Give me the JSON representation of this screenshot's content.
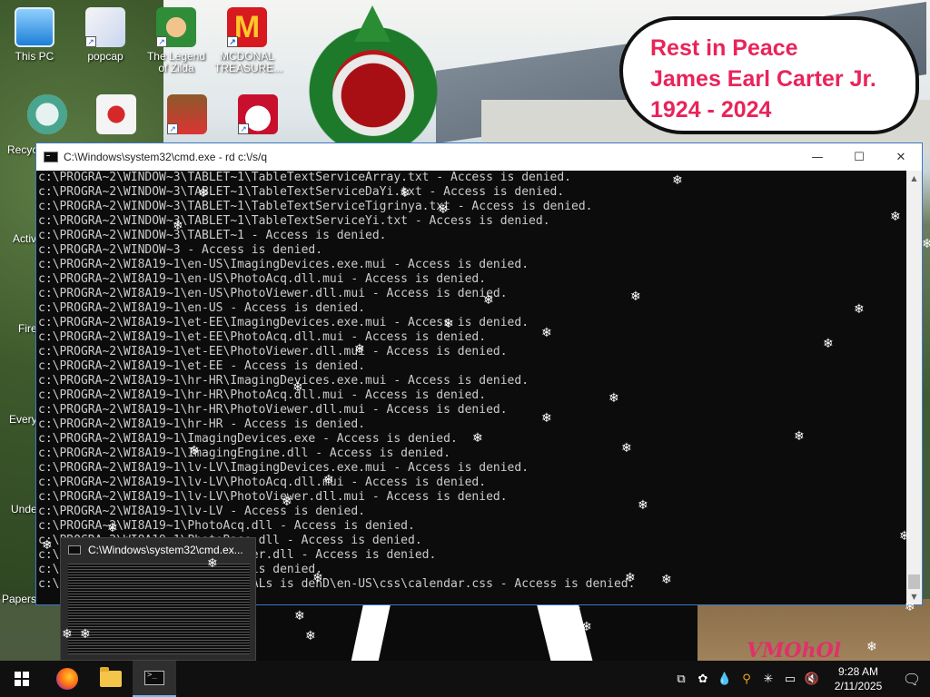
{
  "desktop": {
    "icons": [
      {
        "label": "This PC"
      },
      {
        "label": "popcap"
      },
      {
        "label": "The Legend of Zilda"
      },
      {
        "label": "MCDONAL TREASURE..."
      }
    ],
    "edge_labels": [
      "Recyc",
      "Activ",
      "Fire",
      "Every",
      "Unde",
      "Papers"
    ],
    "memorial": {
      "line1": "Rest in Peace",
      "line2": "James Earl Carter Jr.",
      "line3": "1924 - 2024"
    },
    "wallpaper_text": "VMOhOl"
  },
  "cmd_window": {
    "title": "C:\\Windows\\system32\\cmd.exe - rd  c:\\/s/q",
    "minimize": "—",
    "maximize": "☐",
    "close": "✕",
    "lines": [
      "c:\\PROGRA~2\\WINDOW~3\\TABLET~1\\TableTextServiceArray.txt - Access is denied.",
      "c:\\PROGRA~2\\WINDOW~3\\TABLET~1\\TableTextServiceDaYi.txt - Access is denied.",
      "c:\\PROGRA~2\\WINDOW~3\\TABLET~1\\TableTextServiceTigrinya.txt - Access is denied.",
      "c:\\PROGRA~2\\WINDOW~3\\TABLET~1\\TableTextServiceYi.txt - Access is denied.",
      "c:\\PROGRA~2\\WINDOW~3\\TABLET~1 - Access is denied.",
      "c:\\PROGRA~2\\WINDOW~3 - Access is denied.",
      "c:\\PROGRA~2\\WI8A19~1\\en-US\\ImagingDevices.exe.mui - Access is denied.",
      "c:\\PROGRA~2\\WI8A19~1\\en-US\\PhotoAcq.dll.mui - Access is denied.",
      "c:\\PROGRA~2\\WI8A19~1\\en-US\\PhotoViewer.dll.mui - Access is denied.",
      "c:\\PROGRA~2\\WI8A19~1\\en-US - Access is denied.",
      "c:\\PROGRA~2\\WI8A19~1\\et-EE\\ImagingDevices.exe.mui - Access is denied.",
      "c:\\PROGRA~2\\WI8A19~1\\et-EE\\PhotoAcq.dll.mui - Access is denied.",
      "c:\\PROGRA~2\\WI8A19~1\\et-EE\\PhotoViewer.dll.mui - Access is denied.",
      "c:\\PROGRA~2\\WI8A19~1\\et-EE - Access is denied.",
      "c:\\PROGRA~2\\WI8A19~1\\hr-HR\\ImagingDevices.exe.mui - Access is denied.",
      "c:\\PROGRA~2\\WI8A19~1\\hr-HR\\PhotoAcq.dll.mui - Access is denied.",
      "c:\\PROGRA~2\\WI8A19~1\\hr-HR\\PhotoViewer.dll.mui - Access is denied.",
      "c:\\PROGRA~2\\WI8A19~1\\hr-HR - Access is denied.",
      "c:\\PROGRA~2\\WI8A19~1\\ImagingDevices.exe - Access is denied.",
      "c:\\PROGRA~2\\WI8A19~1\\ImagingEngine.dll - Access is denied.",
      "c:\\PROGRA~2\\WI8A19~1\\lv-LV\\ImagingDevices.exe.mui - Access is denied.",
      "c:\\PROGRA~2\\WI8A19~1\\lv-LV\\PhotoAcq.dll.mui - Access is denied.",
      "c:\\PROGRA~2\\WI8A19~1\\lv-LV\\PhotoViewer.dll.mui - Access is denied.",
      "c:\\PROGRA~2\\WI8A19~1\\lv-LV - Access is denied.",
      "c:\\PROGRA~2\\WI8A19~1\\PhotoAcq.dll - Access is denied.",
      "c:\\PROGRA~2\\WI8A19~1\\PhotoBase.dll - Access is denied.",
      "c:\\PROGRA~2\\WI8A19~1\\PhotoViewer.dll - Access is denied.",
      "c:\\PROGRA~2\\WI8A19~1 - Access is denied.",
      "c:\\PROGRA~2\\WI8A19~1\\Gadgets\\CALs is denD\\en-US\\css\\calendar.css - Access is denied."
    ]
  },
  "taskbar_preview": {
    "title": "C:\\Windows\\system32\\cmd.ex..."
  },
  "taskbar": {
    "start_icon": "windows-logo",
    "apps": [
      "firefox-icon",
      "file-explorer-icon",
      "command-prompt-icon"
    ],
    "clock": {
      "time": "9:28 AM",
      "date": "2/11/2025"
    }
  }
}
